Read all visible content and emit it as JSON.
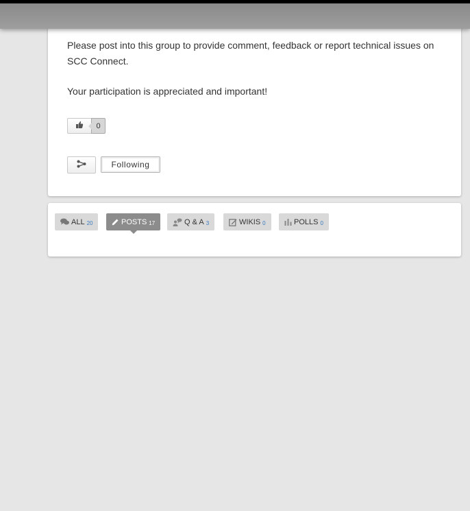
{
  "group": {
    "description_line1": "Please post into this group to provide comment, feedback or report technical issues on SCC Connect.",
    "description_line2": "Your participation is appreciated and important!",
    "like_count": "0",
    "following_label": "Following"
  },
  "tabs": [
    {
      "label": "ALL",
      "count": "20",
      "icon": "comments-icon",
      "active": false
    },
    {
      "label": "POSTS",
      "count": "17",
      "icon": "pencil-icon",
      "active": true
    },
    {
      "label": "Q & A",
      "count": "3",
      "icon": "qa-icon",
      "active": false
    },
    {
      "label": "WIKIS",
      "count": "0",
      "icon": "edit-document-icon",
      "active": false
    },
    {
      "label": "POLLS",
      "count": "0",
      "icon": "bar-chart-icon",
      "active": false
    }
  ],
  "colors": {
    "background": "#e6e6e6",
    "tab_inactive": "#d9d9d9",
    "tab_active": "#8c8c8c",
    "count_link": "#3a7bbf"
  }
}
